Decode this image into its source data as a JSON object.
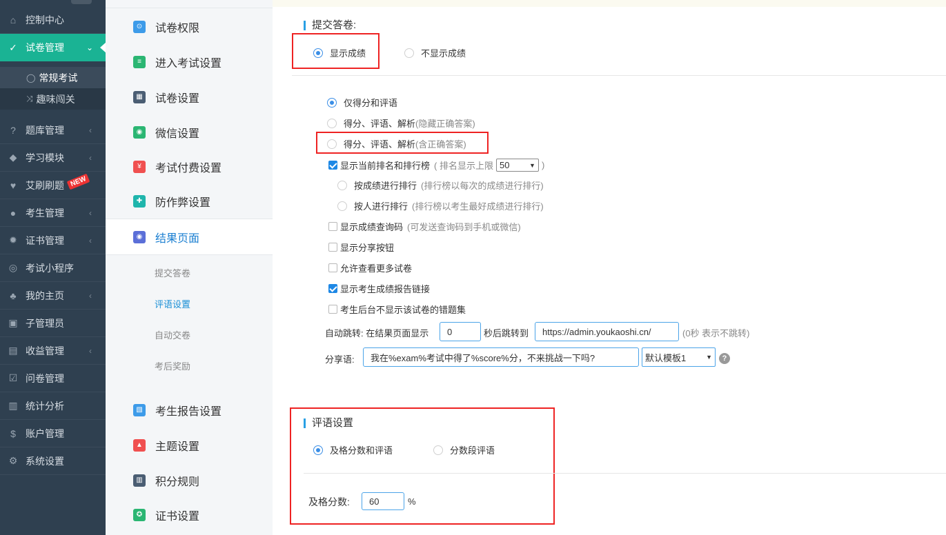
{
  "sidebar": {
    "items": [
      {
        "label": "控制中心",
        "icon": "home-icon",
        "glyph": "⌂"
      },
      {
        "label": "试卷管理",
        "icon": "check-circle-icon",
        "glyph": "✓"
      },
      {
        "label": "题库管理",
        "icon": "question-circle-icon",
        "glyph": "?"
      },
      {
        "label": "学习模块",
        "icon": "graduation-cap-icon",
        "glyph": "◆"
      },
      {
        "label": "艾刷刷题",
        "icon": "heart-icon",
        "glyph": "♥"
      },
      {
        "label": "考生管理",
        "icon": "user-icon",
        "glyph": "●"
      },
      {
        "label": "证书管理",
        "icon": "certificate-icon",
        "glyph": "✹"
      },
      {
        "label": "考试小程序",
        "icon": "wechat-icon",
        "glyph": "◎"
      },
      {
        "label": "我的主页",
        "icon": "leaf-icon",
        "glyph": "♣"
      },
      {
        "label": "子管理员",
        "icon": "lock-icon",
        "glyph": "▣"
      },
      {
        "label": "收益管理",
        "icon": "money-icon",
        "glyph": "▤"
      },
      {
        "label": "问卷管理",
        "icon": "checkbox-icon",
        "glyph": "☑"
      },
      {
        "label": "统计分析",
        "icon": "bar-chart-icon",
        "glyph": "▥"
      },
      {
        "label": "账户管理",
        "icon": "dollar-icon",
        "glyph": "$"
      },
      {
        "label": "系统设置",
        "icon": "gear-icon",
        "glyph": "⚙"
      }
    ],
    "subitems": [
      {
        "label": "常规考试",
        "icon": "check-circle-icon",
        "glyph": "◯"
      },
      {
        "label": "趣味闯关",
        "icon": "shuffle-icon",
        "glyph": "⤨"
      }
    ],
    "new_badge": "NEW",
    "accent": "#1ab394"
  },
  "menu2": {
    "items": [
      {
        "label": "试卷权限",
        "color": "#3d9be9",
        "glyph": "⊙"
      },
      {
        "label": "进入考试设置",
        "color": "#2bb673",
        "glyph": "≡"
      },
      {
        "label": "试卷设置",
        "color": "#4a5d73",
        "glyph": "▦"
      },
      {
        "label": "微信设置",
        "color": "#2bb673",
        "glyph": "◉"
      },
      {
        "label": "考试付费设置",
        "color": "#f05050",
        "glyph": "¥"
      },
      {
        "label": "防作弊设置",
        "color": "#1fb5ac",
        "glyph": "✚"
      },
      {
        "label": "结果页面",
        "color": "#5b6fd8",
        "glyph": "◉"
      },
      {
        "label": "考生报告设置",
        "color": "#3d9be9",
        "glyph": "▧"
      },
      {
        "label": "主题设置",
        "color": "#f05050",
        "glyph": "▲"
      },
      {
        "label": "积分规则",
        "color": "#4a5d73",
        "glyph": "▥"
      },
      {
        "label": "证书设置",
        "color": "#2bb673",
        "glyph": "✪"
      }
    ],
    "subitems": [
      "提交答卷",
      "评语设置",
      "自动交卷",
      "考后奖励"
    ]
  },
  "submit": {
    "title": "提交答卷:",
    "show_score": "显示成绩",
    "hide_score": "不显示成绩",
    "options": [
      {
        "label": "仅得分和评语",
        "hint": ""
      },
      {
        "label": "得分、评语、解析",
        "hint": "(隐藏正确答案)"
      },
      {
        "label": "得分、评语、解析",
        "hint": "(含正确答案)"
      }
    ],
    "rank_label": "显示当前排名和排行榜",
    "rank_hint_pre": "( 排名显示上限",
    "rank_limit": "50",
    "rank_hint_post": ")",
    "rank_by_score": "按成绩进行排行",
    "rank_by_score_hint": "(排行榜以每次的成绩进行排行)",
    "rank_by_person": "按人进行排行",
    "rank_by_person_hint": "(排行榜以考生最好成绩进行排行)",
    "query_code": "显示成绩查询码",
    "query_code_hint": "(可发送查询码到手机或微信)",
    "share_button": "显示分享按钮",
    "more_papers": "允许查看更多试卷",
    "report_link": "显示考生成绩报告链接",
    "hide_wrong": "考生后台不显示该试卷的错题集",
    "redirect_pre": "自动跳转: 在结果页面显示",
    "redirect_seconds": "0",
    "redirect_mid": "秒后跳转到",
    "redirect_url": "https://admin.youkaoshi.cn/",
    "redirect_hint": "(0秒 表示不跳转)",
    "share_label": "分享语:",
    "share_text": "我在%exam%考试中得了%score%分，不来挑战一下吗?",
    "share_template": "默认模板1",
    "help": "?"
  },
  "comment": {
    "title": "评语设置",
    "opt_pass": "及格分数和评语",
    "opt_range": "分数段评语",
    "pass_label": "及格分数:",
    "pass_value": "60",
    "pass_unit": "%"
  }
}
